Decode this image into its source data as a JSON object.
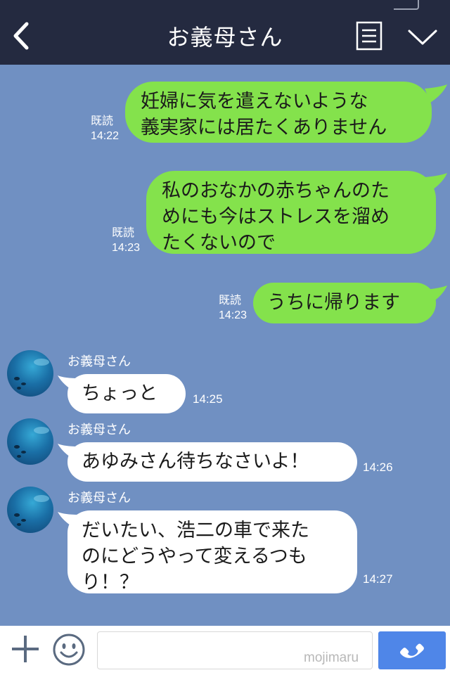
{
  "header": {
    "title": "お義母さん"
  },
  "messages_out": [
    {
      "text_lines": [
        "妊婦に気を遣えないような",
        "義実家には居たくありません"
      ],
      "read": "既読",
      "time": "14:22"
    },
    {
      "text_lines": [
        "私のおなかの赤ちゃんのた",
        "めにも今はストレスを溜め",
        "たくないので"
      ],
      "read": "既読",
      "time": "14:23"
    },
    {
      "text_lines": [
        "うちに帰ります"
      ],
      "read": "既読",
      "time": "14:23"
    }
  ],
  "messages_in": [
    {
      "sender": "お義母さん",
      "text_lines": [
        "ちょっと"
      ],
      "time": "14:25"
    },
    {
      "sender": "お義母さん",
      "text_lines": [
        "あゆみさん待ちなさいよ！"
      ],
      "time": "14:26"
    },
    {
      "sender": "お義母さん",
      "text_lines": [
        "だいたい、浩二の車で来た",
        "のにどうやって変えるつも",
        "り！？"
      ],
      "time": "14:27"
    }
  ],
  "input": {
    "placeholder": "",
    "watermark": "mojimaru"
  },
  "colors": {
    "header_bg": "#242a40",
    "chat_bg": "#7090c2",
    "bubble_out": "#84e24c",
    "bubble_in": "#ffffff",
    "call_button": "#4f86e8"
  },
  "icons": {
    "back": "chevron-left-icon",
    "menu": "list-menu-icon",
    "collapse": "chevron-down-icon",
    "add": "plus-icon",
    "emoji": "smiley-icon",
    "call": "phone-icon"
  }
}
